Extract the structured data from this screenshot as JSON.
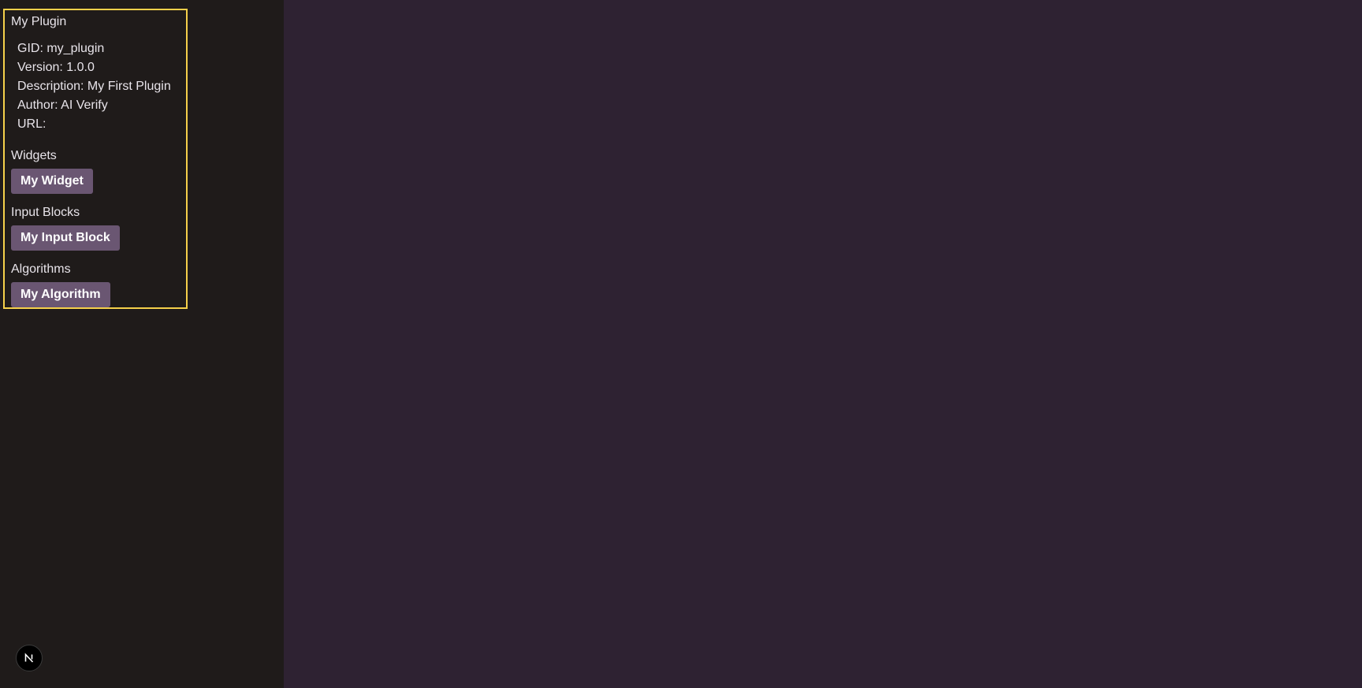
{
  "plugin": {
    "name": "My Plugin",
    "gid_label": "GID: my_plugin",
    "version_label": "Version: 1.0.0",
    "description_label": "Description: My First Plugin",
    "author_label": "Author: AI Verify",
    "url_label": "URL:"
  },
  "sections": {
    "widgets": {
      "title": "Widgets",
      "items": [
        "My Widget"
      ]
    },
    "input_blocks": {
      "title": "Input Blocks",
      "items": [
        "My Input Block"
      ]
    },
    "algorithms": {
      "title": "Algorithms",
      "items": [
        "My Algorithm"
      ]
    }
  },
  "colors": {
    "sidebar_bg": "#1f1b1a",
    "main_bg": "#2e2232",
    "card_border": "#f5d04a",
    "button_bg": "#6a5672"
  },
  "icons": {
    "dev_badge": "nextjs-logo-icon"
  }
}
